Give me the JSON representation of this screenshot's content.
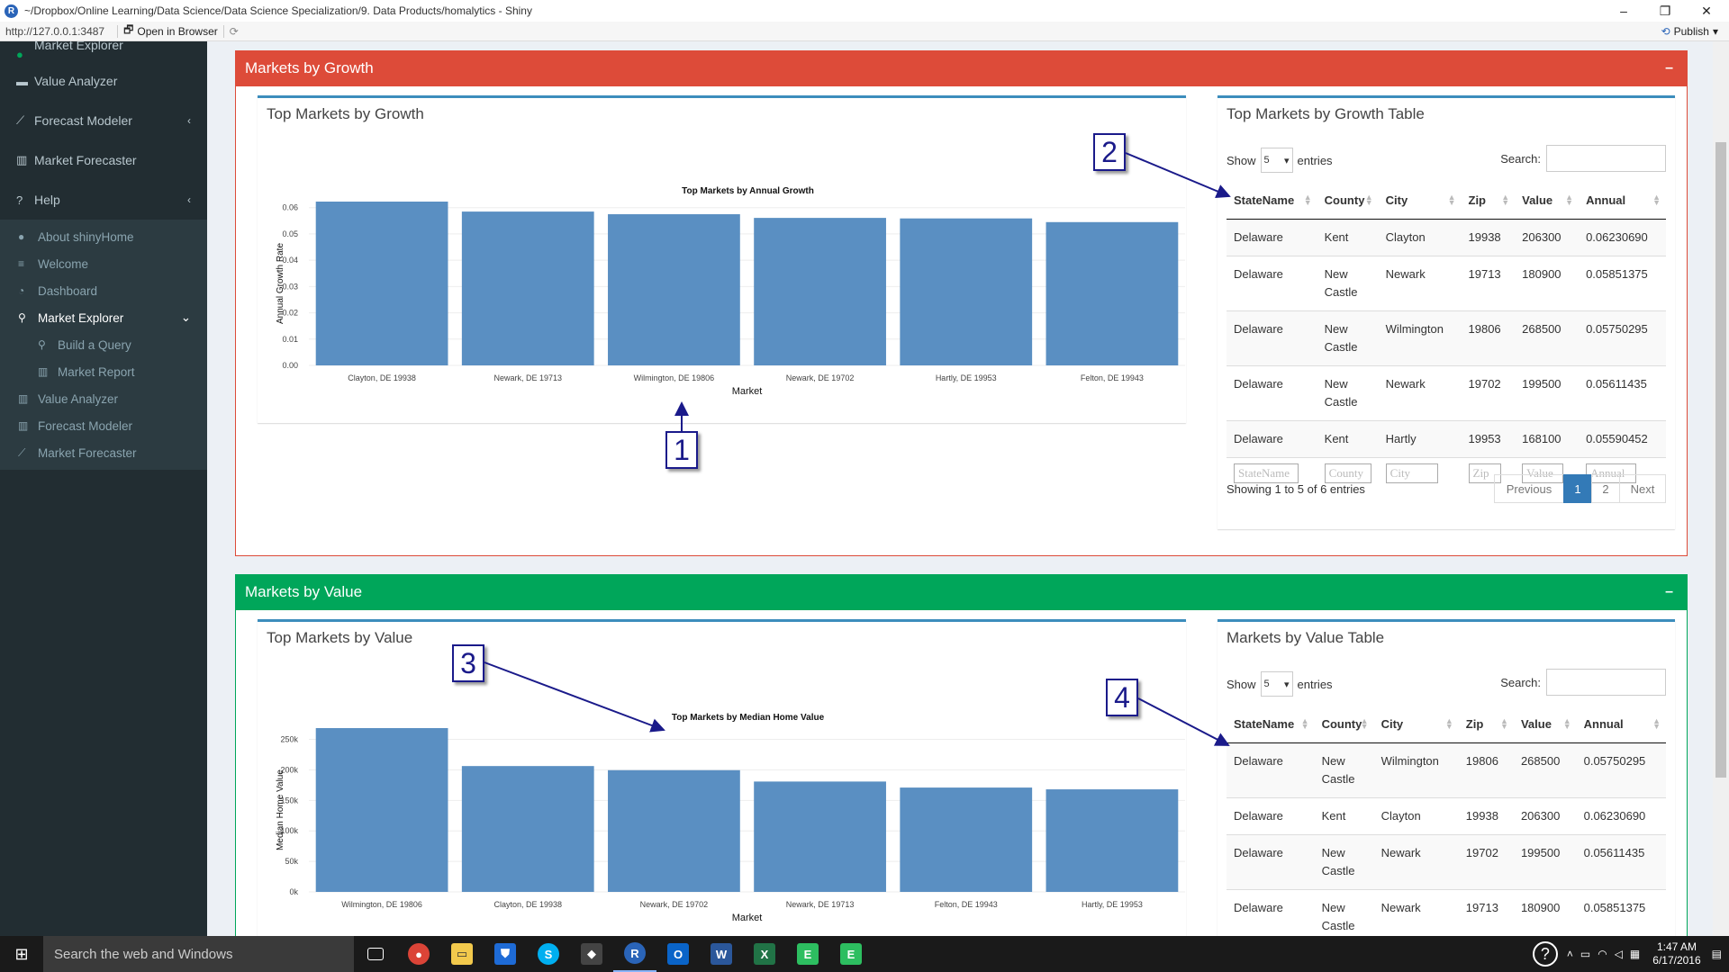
{
  "window": {
    "title": "~/Dropbox/Online Learning/Data Science/Data Science Specialization/9. Data Products/homalytics - Shiny",
    "minimize": "–",
    "maximize": "❐",
    "close": "✕"
  },
  "rstudio": {
    "url": "http://127.0.0.1:3487",
    "open_in_browser": "Open in Browser",
    "publish": "Publish"
  },
  "sidebar": {
    "clipped_item": "Market Explorer",
    "items": [
      {
        "label": "Value Analyzer",
        "icon": "dollar-icon"
      },
      {
        "label": "Forecast Modeler",
        "icon": "line-chart-icon"
      },
      {
        "label": "Market Forecaster",
        "icon": "bar-chart-icon"
      },
      {
        "label": "Help",
        "icon": "question-icon"
      }
    ],
    "help_sub": [
      {
        "label": "About shinyHome",
        "icon": "user-icon"
      },
      {
        "label": "Welcome",
        "icon": "list-icon"
      },
      {
        "label": "Dashboard",
        "icon": "dashboard-icon"
      },
      {
        "label": "Market Explorer",
        "icon": "search-icon"
      },
      {
        "label": "Build a Query",
        "icon": "search-icon"
      },
      {
        "label": "Market Report",
        "icon": "bar-chart-icon"
      },
      {
        "label": "Value Analyzer",
        "icon": "bar-chart-icon"
      },
      {
        "label": "Forecast Modeler",
        "icon": "bar-chart-icon"
      },
      {
        "label": "Market Forecaster",
        "icon": "line-chart-icon"
      }
    ]
  },
  "growth_box": {
    "header": "Markets by Growth",
    "header_color": "#dd4b39",
    "chart_panel_title": "Top Markets by Growth",
    "table_panel_title": "Top Markets by Growth Table",
    "show": "Show",
    "entries": "entries",
    "show_value": "5",
    "search": "Search:",
    "columns": [
      "StateName",
      "County",
      "City",
      "Zip",
      "Value",
      "Annual"
    ],
    "rows": [
      [
        "Delaware",
        "Kent",
        "Clayton",
        "19938",
        "206300",
        "0.06230690"
      ],
      [
        "Delaware",
        "New Castle",
        "Newark",
        "19713",
        "180900",
        "0.05851375"
      ],
      [
        "Delaware",
        "New Castle",
        "Wilmington",
        "19806",
        "268500",
        "0.05750295"
      ],
      [
        "Delaware",
        "New Castle",
        "Newark",
        "19702",
        "199500",
        "0.05611435"
      ],
      [
        "Delaware",
        "Kent",
        "Hartly",
        "19953",
        "168100",
        "0.05590452"
      ]
    ],
    "filters": [
      "StateName",
      "County",
      "City",
      "Zip",
      "Value",
      "Annual"
    ],
    "info": "Showing 1 to 5 of 6 entries",
    "pager": {
      "previous": "Previous",
      "p1": "1",
      "p2": "2",
      "next": "Next"
    }
  },
  "value_box": {
    "header": "Markets by Value",
    "header_color": "#00a65a",
    "chart_panel_title": "Top Markets by Value",
    "table_panel_title": "Markets by Value Table",
    "show": "Show",
    "entries": "entries",
    "show_value": "5",
    "search": "Search:",
    "columns": [
      "StateName",
      "County",
      "City",
      "Zip",
      "Value",
      "Annual"
    ],
    "rows": [
      [
        "Delaware",
        "New Castle",
        "Wilmington",
        "19806",
        "268500",
        "0.05750295"
      ],
      [
        "Delaware",
        "Kent",
        "Clayton",
        "19938",
        "206300",
        "0.06230690"
      ],
      [
        "Delaware",
        "New Castle",
        "Newark",
        "19702",
        "199500",
        "0.05611435"
      ],
      [
        "Delaware",
        "New Castle",
        "Newark",
        "19713",
        "180900",
        "0.05851375"
      ]
    ]
  },
  "chart_data": [
    {
      "type": "bar",
      "title": "Top Markets by Annual Growth",
      "xlabel": "Market",
      "ylabel": "Annual Growth Rate",
      "categories": [
        "Clayton, DE 19938",
        "Newark, DE 19713",
        "Wilmington, DE 19806",
        "Newark, DE 19702",
        "Hartly, DE 19953",
        "Felton, DE 19943"
      ],
      "values": [
        0.0623,
        0.0585,
        0.0575,
        0.0561,
        0.0559,
        0.0545
      ],
      "ylim": [
        0,
        0.0623
      ],
      "yticks": [
        "0.00",
        "0.01",
        "0.02",
        "0.03",
        "0.04",
        "0.05",
        "0.06"
      ],
      "color": "#5a8fc2",
      "grid": true
    },
    {
      "type": "bar",
      "title": "Top Markets by Median Home Value",
      "xlabel": "Market",
      "ylabel": "Median Home Value",
      "categories": [
        "Wilmington, DE 19806",
        "Clayton, DE 19938",
        "Newark, DE 19702",
        "Newark, DE 19713",
        "Felton, DE 19943",
        "Hartly, DE 19953"
      ],
      "values": [
        268500,
        206300,
        199500,
        180900,
        171000,
        168100
      ],
      "ylim": [
        0,
        268500
      ],
      "yticks": [
        "0k",
        "50k",
        "100k",
        "150k",
        "200k",
        "250k"
      ],
      "color": "#5a8fc2",
      "grid": true
    }
  ],
  "callouts": [
    "1",
    "2",
    "3",
    "4"
  ],
  "taskbar": {
    "search": "Search the web and Windows",
    "time": "1:47 AM",
    "date": "6/17/2016"
  }
}
